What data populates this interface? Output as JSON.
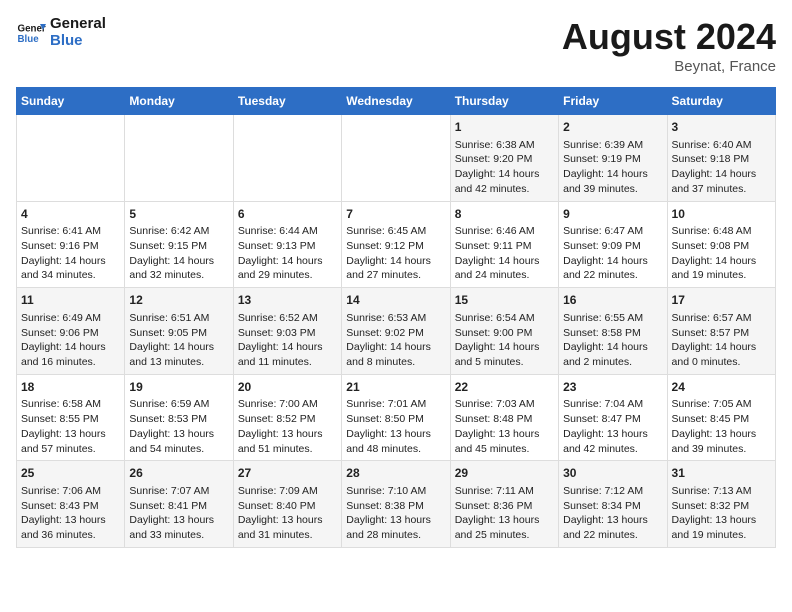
{
  "header": {
    "logo_line1": "General",
    "logo_line2": "Blue",
    "month_year": "August 2024",
    "location": "Beynat, France"
  },
  "days_of_week": [
    "Sunday",
    "Monday",
    "Tuesday",
    "Wednesday",
    "Thursday",
    "Friday",
    "Saturday"
  ],
  "weeks": [
    [
      {
        "day": "",
        "info": ""
      },
      {
        "day": "",
        "info": ""
      },
      {
        "day": "",
        "info": ""
      },
      {
        "day": "",
        "info": ""
      },
      {
        "day": "1",
        "info": "Sunrise: 6:38 AM\nSunset: 9:20 PM\nDaylight: 14 hours\nand 42 minutes."
      },
      {
        "day": "2",
        "info": "Sunrise: 6:39 AM\nSunset: 9:19 PM\nDaylight: 14 hours\nand 39 minutes."
      },
      {
        "day": "3",
        "info": "Sunrise: 6:40 AM\nSunset: 9:18 PM\nDaylight: 14 hours\nand 37 minutes."
      }
    ],
    [
      {
        "day": "4",
        "info": "Sunrise: 6:41 AM\nSunset: 9:16 PM\nDaylight: 14 hours\nand 34 minutes."
      },
      {
        "day": "5",
        "info": "Sunrise: 6:42 AM\nSunset: 9:15 PM\nDaylight: 14 hours\nand 32 minutes."
      },
      {
        "day": "6",
        "info": "Sunrise: 6:44 AM\nSunset: 9:13 PM\nDaylight: 14 hours\nand 29 minutes."
      },
      {
        "day": "7",
        "info": "Sunrise: 6:45 AM\nSunset: 9:12 PM\nDaylight: 14 hours\nand 27 minutes."
      },
      {
        "day": "8",
        "info": "Sunrise: 6:46 AM\nSunset: 9:11 PM\nDaylight: 14 hours\nand 24 minutes."
      },
      {
        "day": "9",
        "info": "Sunrise: 6:47 AM\nSunset: 9:09 PM\nDaylight: 14 hours\nand 22 minutes."
      },
      {
        "day": "10",
        "info": "Sunrise: 6:48 AM\nSunset: 9:08 PM\nDaylight: 14 hours\nand 19 minutes."
      }
    ],
    [
      {
        "day": "11",
        "info": "Sunrise: 6:49 AM\nSunset: 9:06 PM\nDaylight: 14 hours\nand 16 minutes."
      },
      {
        "day": "12",
        "info": "Sunrise: 6:51 AM\nSunset: 9:05 PM\nDaylight: 14 hours\nand 13 minutes."
      },
      {
        "day": "13",
        "info": "Sunrise: 6:52 AM\nSunset: 9:03 PM\nDaylight: 14 hours\nand 11 minutes."
      },
      {
        "day": "14",
        "info": "Sunrise: 6:53 AM\nSunset: 9:02 PM\nDaylight: 14 hours\nand 8 minutes."
      },
      {
        "day": "15",
        "info": "Sunrise: 6:54 AM\nSunset: 9:00 PM\nDaylight: 14 hours\nand 5 minutes."
      },
      {
        "day": "16",
        "info": "Sunrise: 6:55 AM\nSunset: 8:58 PM\nDaylight: 14 hours\nand 2 minutes."
      },
      {
        "day": "17",
        "info": "Sunrise: 6:57 AM\nSunset: 8:57 PM\nDaylight: 14 hours\nand 0 minutes."
      }
    ],
    [
      {
        "day": "18",
        "info": "Sunrise: 6:58 AM\nSunset: 8:55 PM\nDaylight: 13 hours\nand 57 minutes."
      },
      {
        "day": "19",
        "info": "Sunrise: 6:59 AM\nSunset: 8:53 PM\nDaylight: 13 hours\nand 54 minutes."
      },
      {
        "day": "20",
        "info": "Sunrise: 7:00 AM\nSunset: 8:52 PM\nDaylight: 13 hours\nand 51 minutes."
      },
      {
        "day": "21",
        "info": "Sunrise: 7:01 AM\nSunset: 8:50 PM\nDaylight: 13 hours\nand 48 minutes."
      },
      {
        "day": "22",
        "info": "Sunrise: 7:03 AM\nSunset: 8:48 PM\nDaylight: 13 hours\nand 45 minutes."
      },
      {
        "day": "23",
        "info": "Sunrise: 7:04 AM\nSunset: 8:47 PM\nDaylight: 13 hours\nand 42 minutes."
      },
      {
        "day": "24",
        "info": "Sunrise: 7:05 AM\nSunset: 8:45 PM\nDaylight: 13 hours\nand 39 minutes."
      }
    ],
    [
      {
        "day": "25",
        "info": "Sunrise: 7:06 AM\nSunset: 8:43 PM\nDaylight: 13 hours\nand 36 minutes."
      },
      {
        "day": "26",
        "info": "Sunrise: 7:07 AM\nSunset: 8:41 PM\nDaylight: 13 hours\nand 33 minutes."
      },
      {
        "day": "27",
        "info": "Sunrise: 7:09 AM\nSunset: 8:40 PM\nDaylight: 13 hours\nand 31 minutes."
      },
      {
        "day": "28",
        "info": "Sunrise: 7:10 AM\nSunset: 8:38 PM\nDaylight: 13 hours\nand 28 minutes."
      },
      {
        "day": "29",
        "info": "Sunrise: 7:11 AM\nSunset: 8:36 PM\nDaylight: 13 hours\nand 25 minutes."
      },
      {
        "day": "30",
        "info": "Sunrise: 7:12 AM\nSunset: 8:34 PM\nDaylight: 13 hours\nand 22 minutes."
      },
      {
        "day": "31",
        "info": "Sunrise: 7:13 AM\nSunset: 8:32 PM\nDaylight: 13 hours\nand 19 minutes."
      }
    ]
  ]
}
